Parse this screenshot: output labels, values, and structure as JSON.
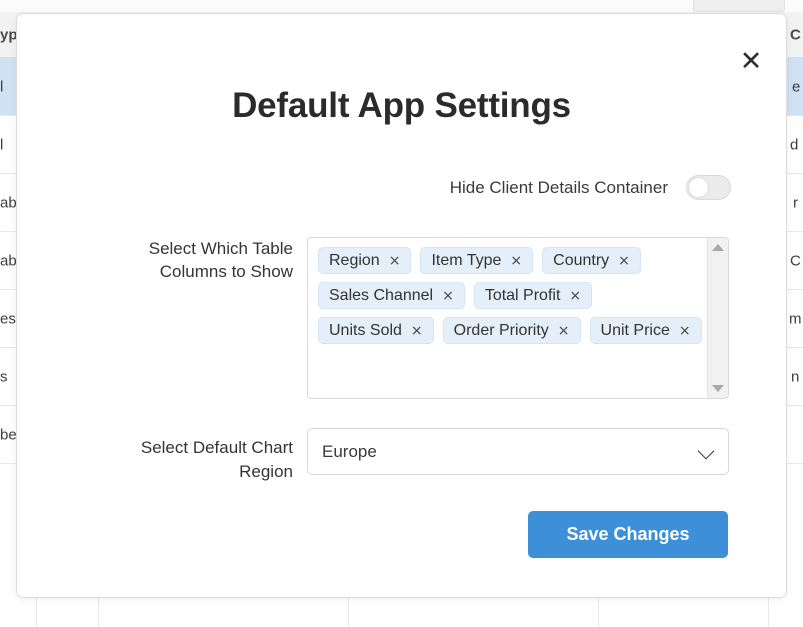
{
  "modal": {
    "title": "Default App Settings",
    "close_icon": "close-icon",
    "toggle": {
      "label": "Hide Client Details Container",
      "state": "off"
    },
    "columns_field": {
      "label": "Select Which Table Columns to Show",
      "label_line1": "Select Which Table",
      "label_line2": "Columns to Show",
      "tags": [
        {
          "label": "Region",
          "remove": "×"
        },
        {
          "label": "Item Type",
          "remove": "×"
        },
        {
          "label": "Country",
          "remove": "×"
        },
        {
          "label": "Sales Channel",
          "remove": "×"
        },
        {
          "label": "Total Profit",
          "remove": "×"
        },
        {
          "label": "Units Sold",
          "remove": "×"
        },
        {
          "label": "Order Priority",
          "remove": "×"
        },
        {
          "label": "Unit Price",
          "remove": "×"
        }
      ]
    },
    "chart_region_field": {
      "label_line1": "Select Default Chart",
      "label_line2": "Region",
      "value": "Europe",
      "chevron_icon": "chevron-down-icon"
    },
    "save_label": "Save Changes"
  },
  "colors": {
    "accent": "#3d90d7",
    "tag_bg": "#e4effa",
    "tag_border": "#d4e5f6",
    "selected_row": "#cfe2f3",
    "title": "#2b2b2b"
  },
  "background_table": {
    "header_cells": [
      "yp",
      "C"
    ],
    "rows": [
      {
        "left": "l",
        "right": "e",
        "selected": true
      },
      {
        "left": "l",
        "right": "d",
        "selected": false
      },
      {
        "left": "ab",
        "right": "r",
        "selected": false
      },
      {
        "left": "ab",
        "right": "C",
        "selected": false
      },
      {
        "left": "es",
        "right": "m",
        "selected": false
      },
      {
        "left": "s",
        "right": "n",
        "selected": false
      },
      {
        "left": "berg",
        "right": "",
        "selected": false
      }
    ]
  }
}
